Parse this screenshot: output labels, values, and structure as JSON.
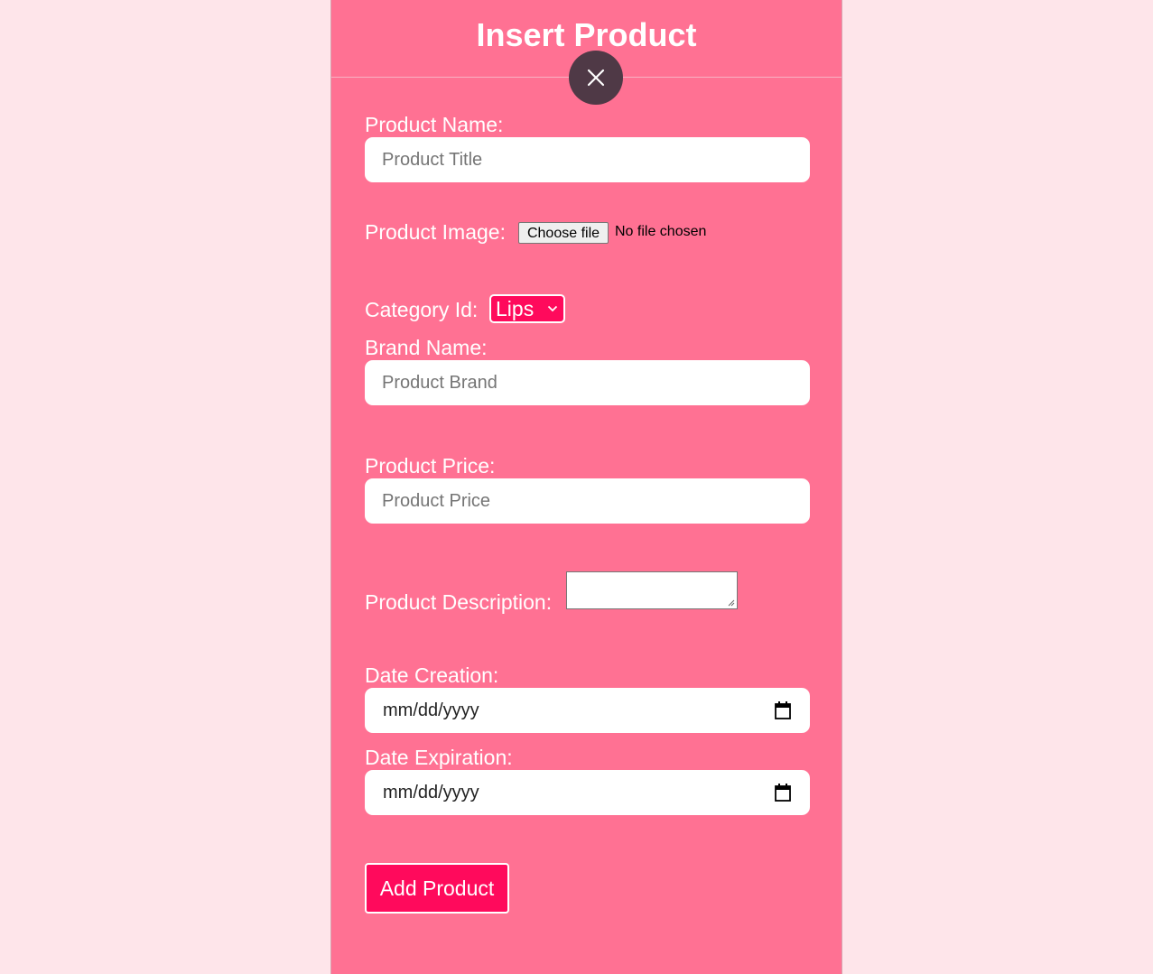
{
  "form": {
    "title": "Insert Product",
    "close_icon": "close-icon",
    "product_name_label": "Product Name:",
    "product_name_placeholder": "Product Title",
    "product_image_label": "Product Image:",
    "choose_file_label": "Choose file",
    "file_status": "No file chosen",
    "category_label": "Category Id:",
    "category_selected": "Lips",
    "brand_label": "Brand Name:",
    "brand_placeholder": "Product Brand",
    "price_label": "Product Price:",
    "price_placeholder": "Product Price",
    "description_label": "Product Description:",
    "date_creation_label": "Date Creation:",
    "date_creation_value": "mm/dd/yyyy",
    "date_expiration_label": "Date Expiration:",
    "date_expiration_value": "mm/dd/yyyy",
    "submit_label": "Add Product"
  },
  "colors": {
    "page_background": "#fee5ea",
    "panel_background": "#ff7193",
    "accent": "#ff0a5c",
    "close_button": "#4f3946"
  }
}
